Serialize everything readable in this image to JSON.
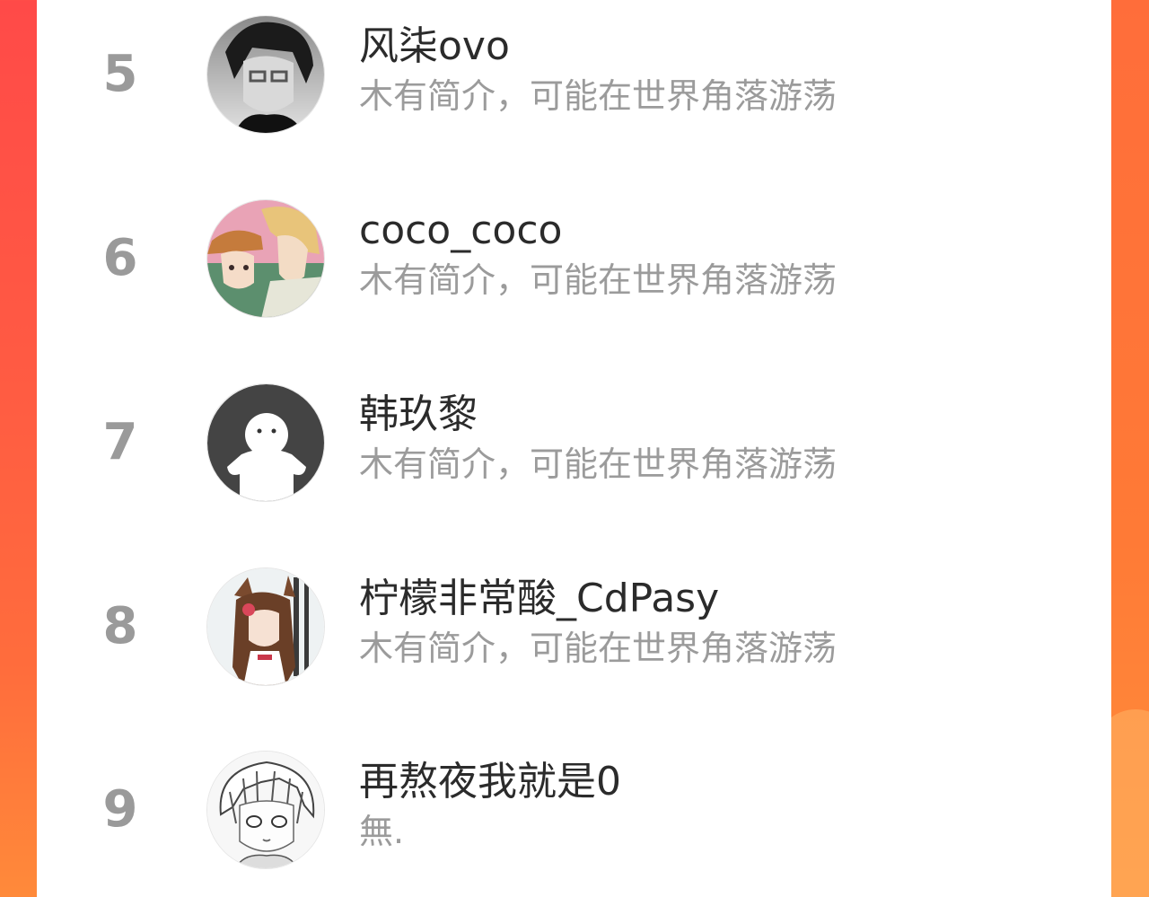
{
  "leaderboard": {
    "rows": [
      {
        "rank": "5",
        "name": "风柒ovo",
        "bio": "木有简介，可能在世界角落游荡",
        "avatar_icon": "avatar-anime-boy-grayscale-icon"
      },
      {
        "rank": "6",
        "name": "coco_coco",
        "bio": "木有简介，可能在世界角落游荡",
        "avatar_icon": "avatar-anime-couple-icon"
      },
      {
        "rank": "7",
        "name": "韩玖黎",
        "bio": "木有简介，可能在世界角落游荡",
        "avatar_icon": "avatar-default-ghost-icon"
      },
      {
        "rank": "8",
        "name": "柠檬非常酸_CdPasy",
        "bio": "木有简介，可能在世界角落游荡",
        "avatar_icon": "avatar-anime-girl-icon"
      },
      {
        "rank": "9",
        "name": "再熬夜我就是0",
        "bio": "無.",
        "avatar_icon": "avatar-anime-sketch-icon"
      }
    ]
  },
  "colors": {
    "background_gradient_start": "#ff4a48",
    "background_gradient_end": "#ff8a3a",
    "panel": "#ffffff",
    "rank_text": "#9a9a9a",
    "name_text": "#2b2b2b",
    "bio_text": "#9b9b9b"
  }
}
